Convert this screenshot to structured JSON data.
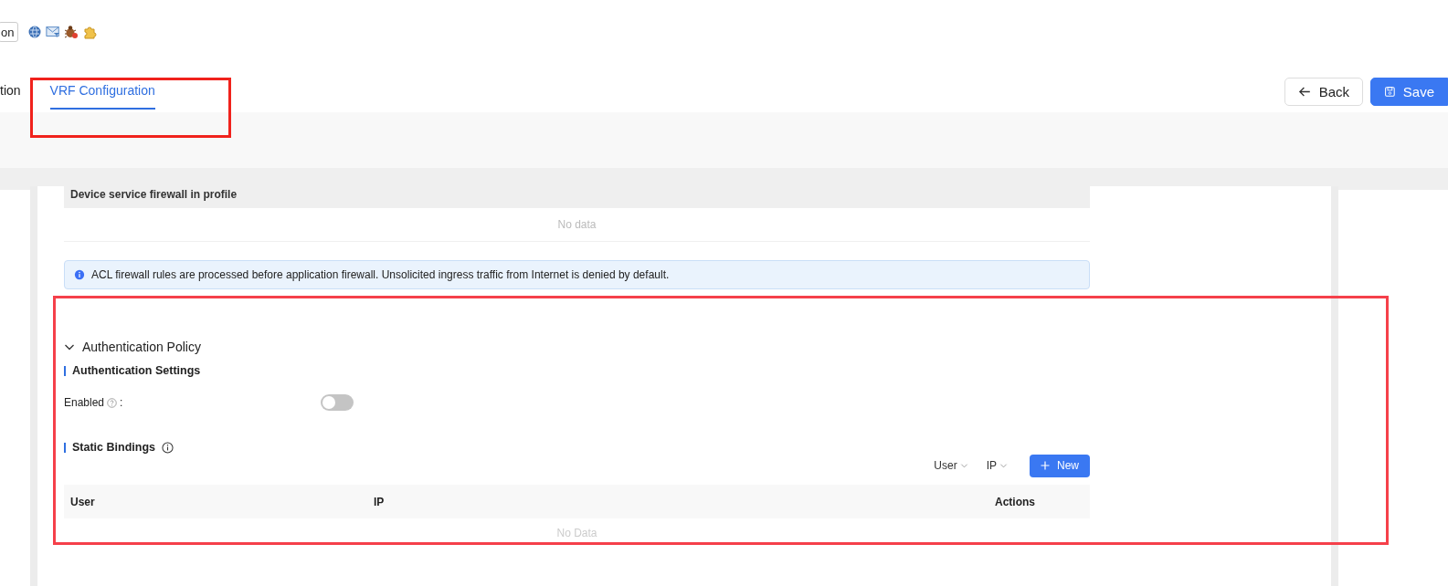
{
  "toolbar": {
    "button": "on"
  },
  "tabs": [
    {
      "label": "tion",
      "selected": false
    },
    {
      "label": "VRF Configuration",
      "selected": true
    }
  ],
  "actions": [
    {
      "label": "Back",
      "kind": "back"
    },
    {
      "label": "Save",
      "kind": "save"
    }
  ],
  "firewall_table": {
    "header": "Device service firewall in profile",
    "empty": "No data"
  },
  "alert": "ACL firewall rules are processed before application firewall. Unsolicited ingress traffic from Internet is denied by default.",
  "auth_policy": {
    "title": "Authentication Policy",
    "expanded": true,
    "settings_title": "Authentication Settings",
    "enabled_label": "Enabled",
    "enabled_suffix": ":",
    "enabled": false,
    "bindings_title": "Static Bindings",
    "filters": [
      "User",
      "IP"
    ],
    "new_button": "New",
    "columns": [
      "User",
      "IP",
      "Actions"
    ],
    "empty": "No Data"
  }
}
